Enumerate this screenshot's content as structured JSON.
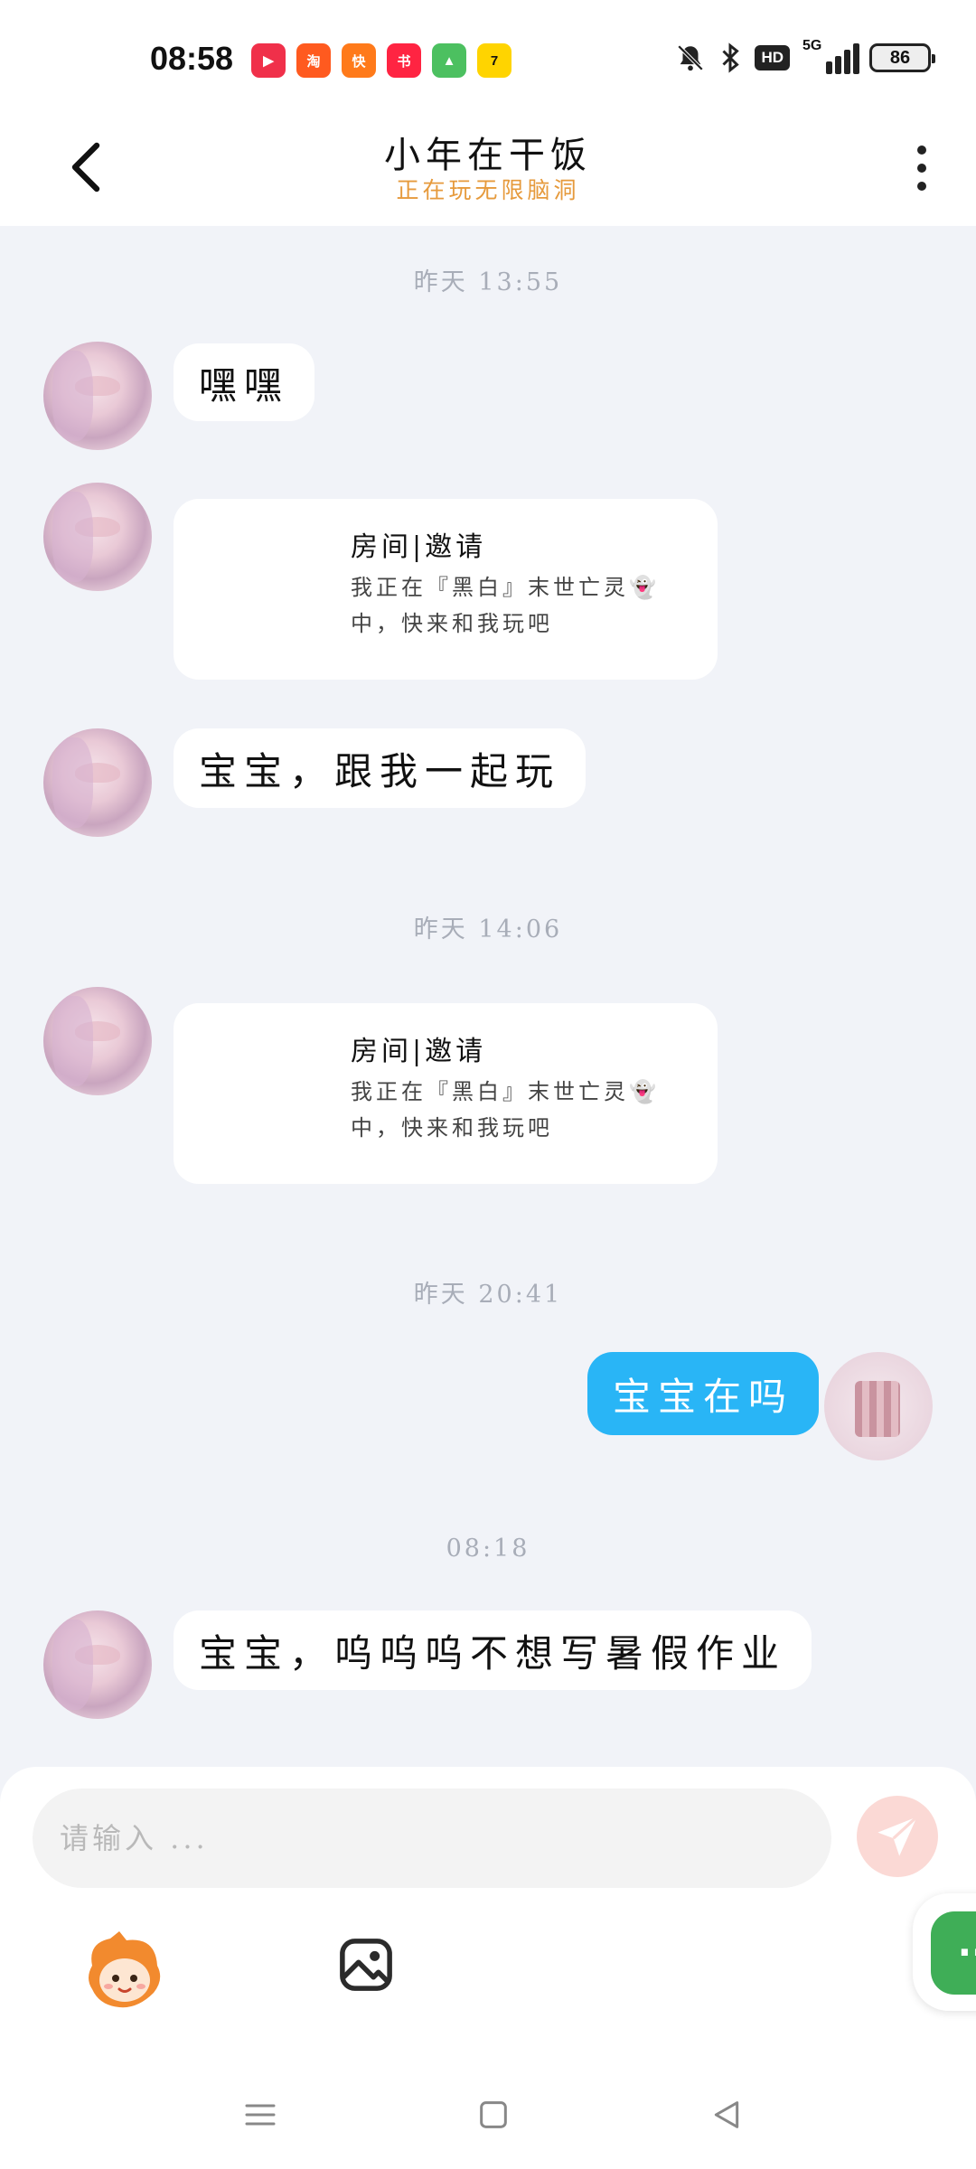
{
  "status_bar": {
    "time": "08:58",
    "hd": "HD",
    "network": "5G",
    "battery": "86",
    "app_icons": [
      "video-app",
      "taobao",
      "kuaishou",
      "xiaohongshu",
      "game-app",
      "tencent-app"
    ]
  },
  "header": {
    "title": "小年在干饭",
    "subtitle": "正在玩无限脑洞"
  },
  "messages": {
    "ts1": "昨天 13:55",
    "m1": "嘿嘿",
    "invite1": {
      "title": "房间|邀请",
      "desc": "我正在『黑白』末世亡灵👻中，快来和我玩吧"
    },
    "m2": "宝宝，跟我一起玩",
    "ts2": "昨天 14:06",
    "invite2": {
      "title": "房间|邀请",
      "desc": "我正在『黑白』末世亡灵👻中，快来和我玩吧"
    },
    "ts3": "昨天 20:41",
    "m3_me": "宝宝在吗",
    "ts4": "08:18",
    "m4": "宝宝，呜呜呜不想写暑假作业"
  },
  "composer": {
    "placeholder": "请输入 ...",
    "float_button": "··"
  },
  "colors": {
    "accent_blue": "#29b5f6",
    "subtitle_orange": "#e69a3c",
    "background": "#f1f3f8",
    "send_pink": "#fbd9d5",
    "float_green": "#3fae57"
  }
}
